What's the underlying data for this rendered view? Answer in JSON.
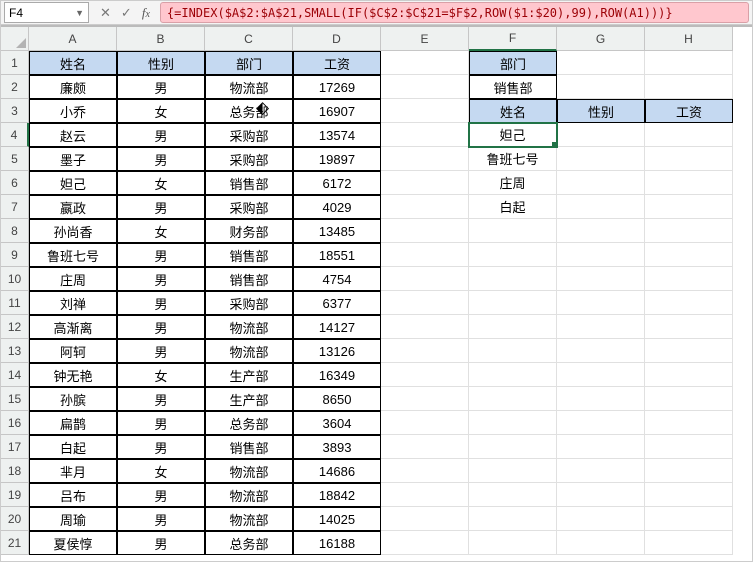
{
  "nameBox": "F4",
  "formulaText": "{=INDEX($A$2:$A$21,SMALL(IF($C$2:$C$21=$F$2,ROW($1:$20),99),ROW(A1)))}",
  "colHeaders": [
    "A",
    "B",
    "C",
    "D",
    "E",
    "F",
    "G",
    "H"
  ],
  "rowHeaders": [
    "1",
    "2",
    "3",
    "4",
    "5",
    "6",
    "7",
    "8",
    "9",
    "10",
    "11",
    "12",
    "13",
    "14",
    "15",
    "16",
    "17",
    "18",
    "19",
    "20",
    "21"
  ],
  "mainTable": {
    "headers": [
      "姓名",
      "性别",
      "部门",
      "工资"
    ],
    "rows": [
      [
        "廉颇",
        "男",
        "物流部",
        "17269"
      ],
      [
        "小乔",
        "女",
        "总务部",
        "16907"
      ],
      [
        "赵云",
        "男",
        "采购部",
        "13574"
      ],
      [
        "墨子",
        "男",
        "采购部",
        "19897"
      ],
      [
        "妲己",
        "女",
        "销售部",
        "6172"
      ],
      [
        "嬴政",
        "男",
        "采购部",
        "4029"
      ],
      [
        "孙尚香",
        "女",
        "财务部",
        "13485"
      ],
      [
        "鲁班七号",
        "男",
        "销售部",
        "18551"
      ],
      [
        "庄周",
        "男",
        "销售部",
        "4754"
      ],
      [
        "刘禅",
        "男",
        "采购部",
        "6377"
      ],
      [
        "高渐离",
        "男",
        "物流部",
        "14127"
      ],
      [
        "阿轲",
        "男",
        "物流部",
        "13126"
      ],
      [
        "钟无艳",
        "女",
        "生产部",
        "16349"
      ],
      [
        "孙膑",
        "男",
        "生产部",
        "8650"
      ],
      [
        "扁鹊",
        "男",
        "总务部",
        "3604"
      ],
      [
        "白起",
        "男",
        "销售部",
        "3893"
      ],
      [
        "芈月",
        "女",
        "物流部",
        "14686"
      ],
      [
        "吕布",
        "男",
        "物流部",
        "18842"
      ],
      [
        "周瑜",
        "男",
        "物流部",
        "14025"
      ],
      [
        "夏侯惇",
        "男",
        "总务部",
        "16188"
      ]
    ]
  },
  "lookup": {
    "deptLabel": "部门",
    "deptValue": "销售部",
    "cols": [
      "姓名",
      "性别",
      "工资"
    ],
    "results": [
      "妲己",
      "鲁班七号",
      "庄周",
      "白起"
    ]
  },
  "selectedCell": "F4",
  "activeCol": 6,
  "activeRow": 4
}
